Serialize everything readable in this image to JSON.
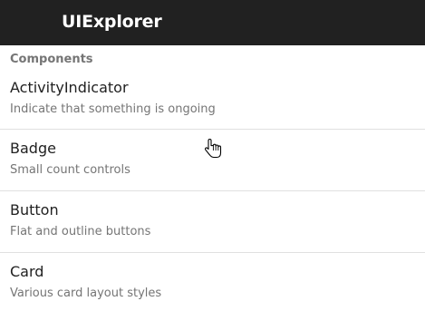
{
  "appbar": {
    "title": "UIExplorer"
  },
  "section": {
    "header": "Components"
  },
  "items": [
    {
      "title": "ActivityIndicator",
      "subtitle": "Indicate that something is ongoing"
    },
    {
      "title": "Badge",
      "subtitle": "Small count controls"
    },
    {
      "title": "Button",
      "subtitle": "Flat and outline buttons"
    },
    {
      "title": "Card",
      "subtitle": "Various card layout styles"
    }
  ],
  "cursor": {
    "icon": "hand-pointer-icon"
  },
  "colors": {
    "appbar_bg": "#212121",
    "appbar_text": "#ffffff",
    "subheader_text": "#757575",
    "primary_text": "#212121",
    "secondary_text": "#757575",
    "divider": "#e0e0e0"
  }
}
